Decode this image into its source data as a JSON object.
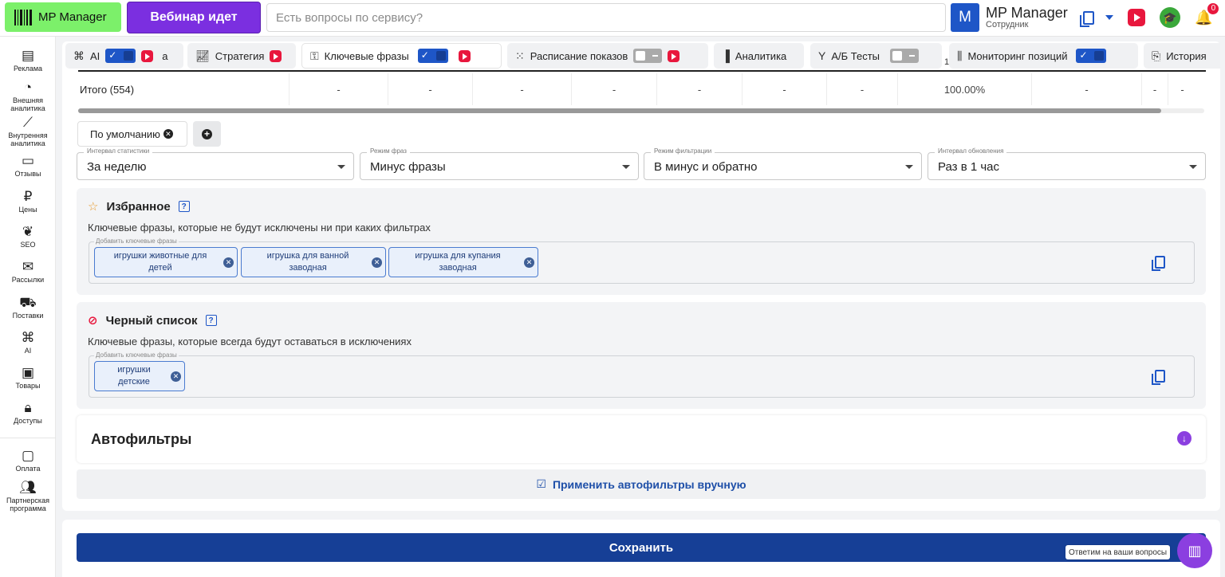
{
  "header": {
    "logo_label": "MP Manager",
    "webinar_label": "Вебинар идет",
    "search_placeholder": "Есть вопросы по сервису?",
    "user_initial": "M",
    "user_name": "MP Manager",
    "user_role": "Сотрудник",
    "notifications_count": "0"
  },
  "sidebar": {
    "items": [
      {
        "label": "Реклама",
        "icon": "ad-icon"
      },
      {
        "label": "Внешняя аналитика",
        "icon": "pie-chart-icon"
      },
      {
        "label": "Внутренняя аналитика",
        "icon": "trend-icon"
      },
      {
        "label": "Отзывы",
        "icon": "message-icon"
      },
      {
        "label": "Цены",
        "icon": "ruble-icon"
      },
      {
        "label": "SEO",
        "icon": "seo-icon"
      },
      {
        "label": "Рассылки",
        "icon": "mail-icon"
      },
      {
        "label": "Поставки",
        "icon": "truck-icon"
      },
      {
        "label": "AI",
        "icon": "chip-icon"
      },
      {
        "label": "Товары",
        "icon": "box-icon"
      },
      {
        "label": "Доступы",
        "icon": "lock-icon"
      },
      {
        "label": "Оплата",
        "icon": "wallet-icon"
      },
      {
        "label": "Партнерская программа",
        "icon": "partners-icon"
      }
    ]
  },
  "tabs": {
    "ai": "AI",
    "partial": "а",
    "strategy": "Стратегия",
    "keywords": "Ключевые фразы",
    "schedule": "Расписание показов",
    "analytics": "Аналитика",
    "ab_tests": "А/Б Тесты",
    "ab_count": "1",
    "monitoring": "Мониторинг позиций",
    "history": "История"
  },
  "totals": {
    "label": "Итого (554)",
    "cells": [
      "-",
      "-",
      "-",
      "-",
      "-",
      "-",
      "-",
      "100.00%",
      "-",
      "-",
      "-"
    ]
  },
  "preset": {
    "chip_label": "По умолчанию"
  },
  "selects": [
    {
      "label": "Интервал статистики",
      "value": "За неделю"
    },
    {
      "label": "Режим фраз",
      "value": "Минус фразы"
    },
    {
      "label": "Режим фильтрации",
      "value": "В минус и обратно"
    },
    {
      "label": "Интервал обновления",
      "value": "Раз в 1 час"
    }
  ],
  "favorites": {
    "title": "Избранное",
    "description": "Ключевые фразы, которые не будут исключены ни при каких фильтрах",
    "input_label": "Добавить ключевые фразы",
    "tags": [
      "игрушки животные для детей",
      "игрушка для ванной заводная",
      "игрушка для купания заводная"
    ]
  },
  "blacklist": {
    "title": "Черный список",
    "description": "Ключевые фразы, которые всегда будут оставаться в исключениях",
    "input_label": "Добавить ключевые фразы",
    "tags": [
      "игрушки детские"
    ]
  },
  "autofilters": {
    "title": "Автофильтры",
    "apply_label": "Применить автофильтры вручную"
  },
  "footer": {
    "save_label": "Сохранить",
    "help_tooltip": "Ответим на ваши вопросы"
  },
  "colors": {
    "accent": "#1e56c7",
    "save": "#163f96",
    "webinar": "#7b2fe0",
    "logo": "#7cf06a",
    "danger": "#e8173d"
  }
}
